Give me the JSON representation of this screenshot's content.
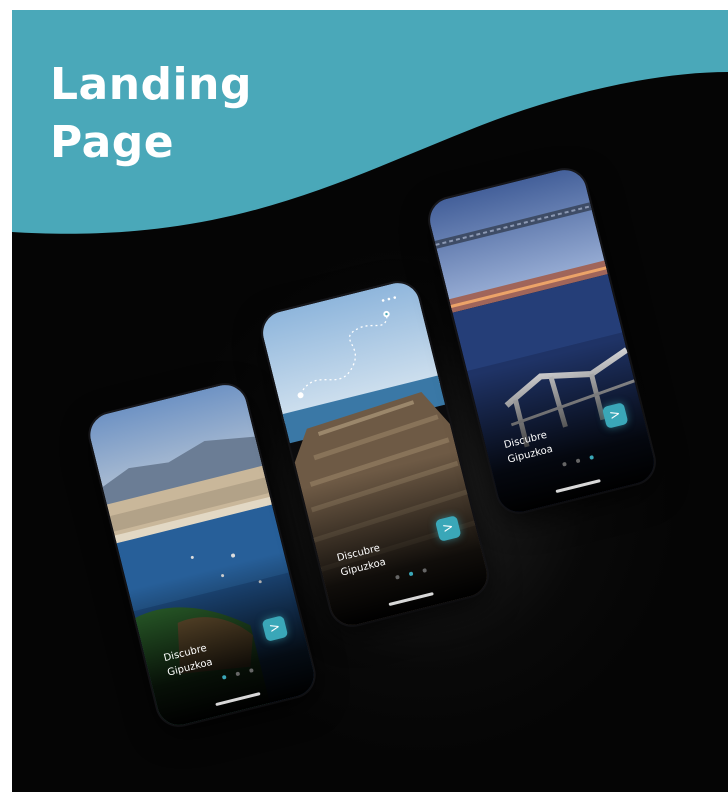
{
  "header": {
    "title_line1": "Landing",
    "title_line2": "Page",
    "band_color": "#4aa8b9"
  },
  "accent_color": "#3aa7b8",
  "phones": [
    {
      "id": "phone-left",
      "scene": "coastal-city-bay",
      "cta_line1": "Discubre",
      "cta_line2": "Gipuzkoa",
      "next_icon": "chevron-right-icon",
      "next_glyph": ">",
      "active_dot": 0
    },
    {
      "id": "phone-center",
      "scene": "rock-coast-with-route",
      "cta_line1": "Discubre",
      "cta_line2": "Gipuzkoa",
      "next_icon": "chevron-right-icon",
      "next_glyph": ">",
      "active_dot": 1
    },
    {
      "id": "phone-right",
      "scene": "promenade-railing-dusk",
      "cta_line1": "Discubre",
      "cta_line2": "Gipuzkoa",
      "next_icon": "chevron-right-icon",
      "next_glyph": ">",
      "active_dot": 2
    }
  ]
}
